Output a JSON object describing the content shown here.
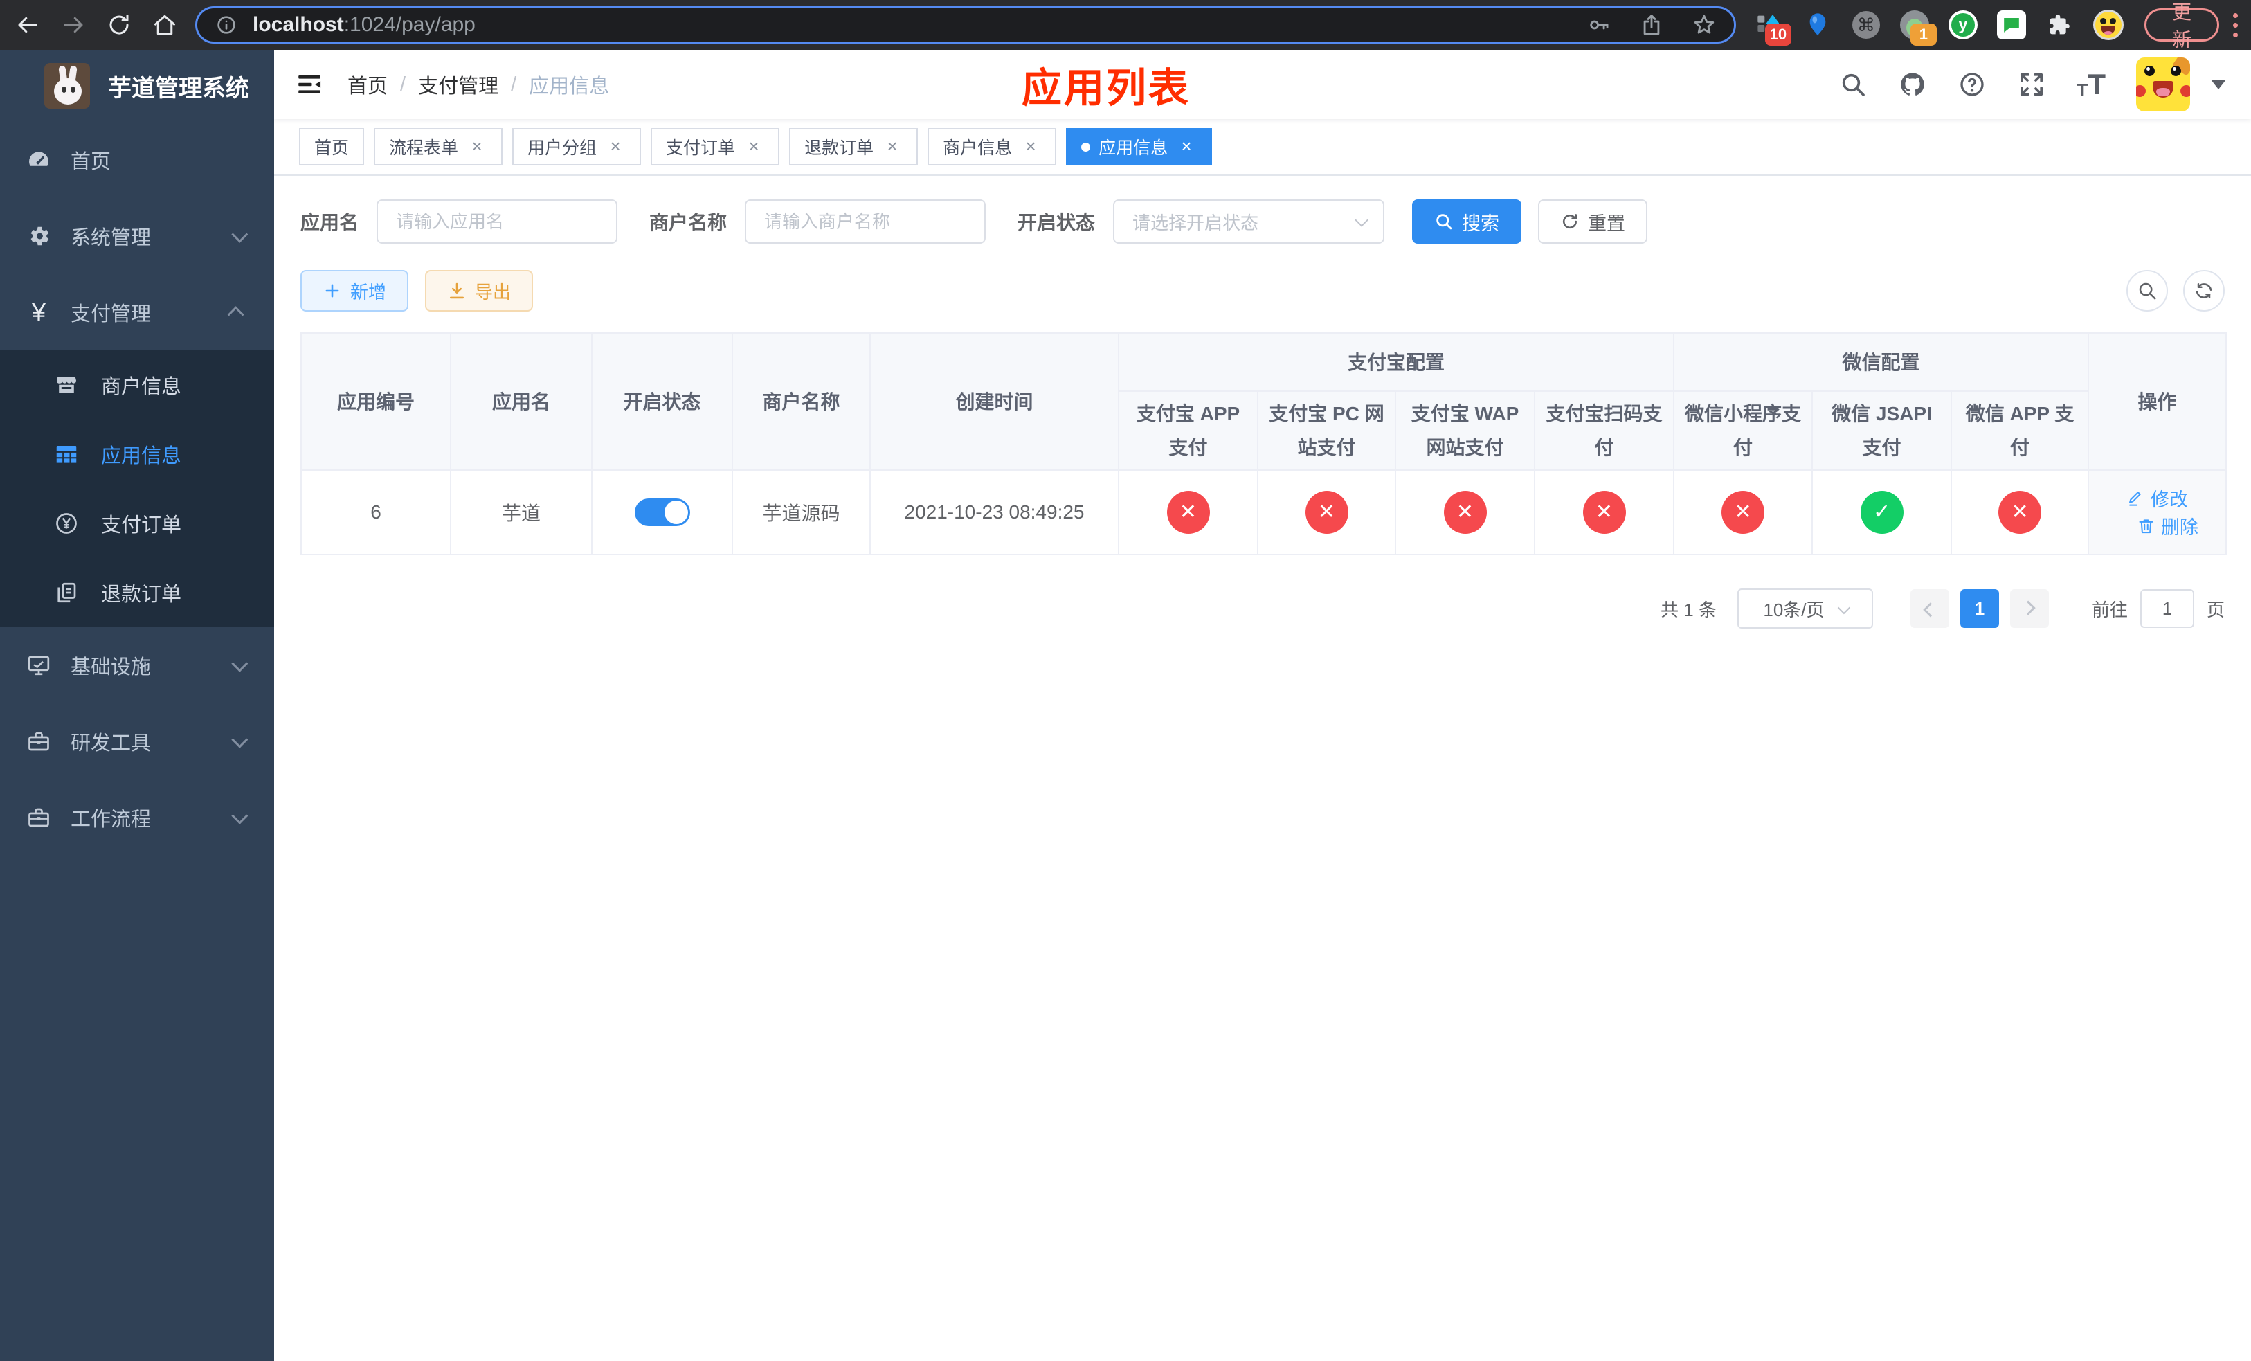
{
  "browser": {
    "url_host": "localhost",
    "url_path": ":1024/pay/app",
    "ext_badge_blue": "10",
    "ext_badge_avatar": "1",
    "update_label": "更新"
  },
  "sidebar": {
    "title": "芋道管理系统",
    "home": "首页",
    "system": "系统管理",
    "payment": "支付管理",
    "sub": [
      "商户信息",
      "应用信息",
      "支付订单",
      "退款订单"
    ],
    "infra": "基础设施",
    "devtools": "研发工具",
    "workflow": "工作流程"
  },
  "navbar": {
    "breadcrumb": [
      "首页",
      "支付管理",
      "应用信息"
    ],
    "separator": "/",
    "annotation": "应用列表"
  },
  "tabs": {
    "items": [
      "首页",
      "流程表单",
      "用户分组",
      "支付订单",
      "退款订单",
      "商户信息",
      "应用信息"
    ],
    "close_glyph": "×"
  },
  "filters": {
    "app_name_label": "应用名",
    "app_name_placeholder": "请输入应用名",
    "merchant_label": "商户名称",
    "merchant_placeholder": "请输入商户名称",
    "status_label": "开启状态",
    "status_placeholder": "请选择开启状态",
    "search": "搜索",
    "reset": "重置"
  },
  "toolbar": {
    "add": "新增",
    "export": "导出"
  },
  "table": {
    "groups": {
      "alipay": "支付宝配置",
      "wechat": "微信配置"
    },
    "headers": {
      "app_id": "应用编号",
      "app_name": "应用名",
      "status": "开启状态",
      "merchant": "商户名称",
      "created": "创建时间",
      "actions": "操作"
    },
    "channel_headers": [
      "支付宝 APP 支付",
      "支付宝 PC 网站支付",
      "支付宝 WAP 网站支付",
      "支付宝扫码支付",
      "微信小程序支付",
      "微信 JSAPI 支付",
      "微信 APP 支付"
    ],
    "row": {
      "app_id": "6",
      "app_name": "芋道",
      "enabled": true,
      "merchant": "芋道源码",
      "created": "2021-10-23 08:49:25",
      "channels": [
        false,
        false,
        false,
        false,
        false,
        true,
        false
      ],
      "edit": "修改",
      "delete": "删除"
    }
  },
  "pagination": {
    "total": "共 1 条",
    "page_size": "10条/页",
    "current_page": "1",
    "goto_label": "前往",
    "goto_value": "1",
    "page_unit": "页"
  },
  "colors": {
    "primary": "#409eff",
    "success": "#13ce66",
    "danger": "#f5494d",
    "warning": "#e6a23c",
    "annotation": "#ff2d00"
  }
}
